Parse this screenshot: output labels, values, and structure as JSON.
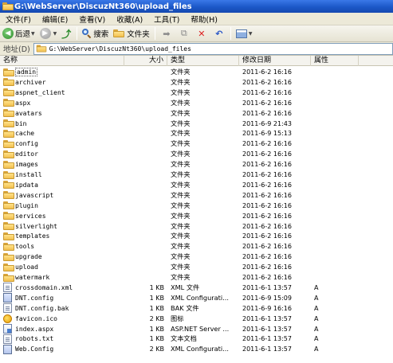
{
  "window": {
    "title": "G:\\WebServer\\DiscuzNt360\\upload_files"
  },
  "menu": [
    "文件(F)",
    "编辑(E)",
    "查看(V)",
    "收藏(A)",
    "工具(T)",
    "帮助(H)"
  ],
  "toolbar": {
    "back_label": "后退",
    "search_label": "搜索",
    "folders_label": "文件夹"
  },
  "address": {
    "label": "地址(D)",
    "value": "G:\\WebServer\\DiscuzNt360\\upload_files"
  },
  "columns": {
    "name": "名称",
    "size": "大小",
    "type": "类型",
    "date": "修改日期",
    "attr": "属性"
  },
  "files": [
    {
      "name": "admin",
      "size": "",
      "type": "文件夹",
      "date": "2011-6-2 16:16",
      "attr": "",
      "icon": "folder-icon"
    },
    {
      "name": "archiver",
      "size": "",
      "type": "文件夹",
      "date": "2011-6-2 16:16",
      "attr": "",
      "icon": "folder-icon"
    },
    {
      "name": "aspnet_client",
      "size": "",
      "type": "文件夹",
      "date": "2011-6-2 16:16",
      "attr": "",
      "icon": "folder-icon"
    },
    {
      "name": "aspx",
      "size": "",
      "type": "文件夹",
      "date": "2011-6-2 16:16",
      "attr": "",
      "icon": "folder-icon"
    },
    {
      "name": "avatars",
      "size": "",
      "type": "文件夹",
      "date": "2011-6-2 16:16",
      "attr": "",
      "icon": "folder-icon"
    },
    {
      "name": "bin",
      "size": "",
      "type": "文件夹",
      "date": "2011-6-9 21:43",
      "attr": "",
      "icon": "folder-icon"
    },
    {
      "name": "cache",
      "size": "",
      "type": "文件夹",
      "date": "2011-6-9 15:13",
      "attr": "",
      "icon": "folder-icon"
    },
    {
      "name": "config",
      "size": "",
      "type": "文件夹",
      "date": "2011-6-2 16:16",
      "attr": "",
      "icon": "folder-icon"
    },
    {
      "name": "editor",
      "size": "",
      "type": "文件夹",
      "date": "2011-6-2 16:16",
      "attr": "",
      "icon": "folder-icon"
    },
    {
      "name": "images",
      "size": "",
      "type": "文件夹",
      "date": "2011-6-2 16:16",
      "attr": "",
      "icon": "folder-icon"
    },
    {
      "name": "install",
      "size": "",
      "type": "文件夹",
      "date": "2011-6-2 16:16",
      "attr": "",
      "icon": "folder-icon"
    },
    {
      "name": "ipdata",
      "size": "",
      "type": "文件夹",
      "date": "2011-6-2 16:16",
      "attr": "",
      "icon": "folder-icon"
    },
    {
      "name": "javascript",
      "size": "",
      "type": "文件夹",
      "date": "2011-6-2 16:16",
      "attr": "",
      "icon": "folder-icon"
    },
    {
      "name": "plugin",
      "size": "",
      "type": "文件夹",
      "date": "2011-6-2 16:16",
      "attr": "",
      "icon": "folder-icon"
    },
    {
      "name": "services",
      "size": "",
      "type": "文件夹",
      "date": "2011-6-2 16:16",
      "attr": "",
      "icon": "folder-icon"
    },
    {
      "name": "silverlight",
      "size": "",
      "type": "文件夹",
      "date": "2011-6-2 16:16",
      "attr": "",
      "icon": "folder-icon"
    },
    {
      "name": "templates",
      "size": "",
      "type": "文件夹",
      "date": "2011-6-2 16:16",
      "attr": "",
      "icon": "folder-icon"
    },
    {
      "name": "tools",
      "size": "",
      "type": "文件夹",
      "date": "2011-6-2 16:16",
      "attr": "",
      "icon": "folder-icon"
    },
    {
      "name": "upgrade",
      "size": "",
      "type": "文件夹",
      "date": "2011-6-2 16:16",
      "attr": "",
      "icon": "folder-icon"
    },
    {
      "name": "upload",
      "size": "",
      "type": "文件夹",
      "date": "2011-6-2 16:16",
      "attr": "",
      "icon": "folder-icon"
    },
    {
      "name": "watermark",
      "size": "",
      "type": "文件夹",
      "date": "2011-6-2 16:16",
      "attr": "",
      "icon": "folder-icon"
    },
    {
      "name": "crossdomain.xml",
      "size": "1 KB",
      "type": "XML 文件",
      "date": "2011-6-1 13:57",
      "attr": "A",
      "icon": "xml-file-icon"
    },
    {
      "name": "DNT.config",
      "size": "1 KB",
      "type": "XML Configurati...",
      "date": "2011-6-9 15:09",
      "attr": "A",
      "icon": "config-file-icon"
    },
    {
      "name": "DNT.config.bak",
      "size": "1 KB",
      "type": "BAK 文件",
      "date": "2011-6-9 16:16",
      "attr": "A",
      "icon": "bak-file-icon"
    },
    {
      "name": "favicon.ico",
      "size": "2 KB",
      "type": "图标",
      "date": "2011-6-1 13:57",
      "attr": "A",
      "icon": "favicon-icon"
    },
    {
      "name": "index.aspx",
      "size": "1 KB",
      "type": "ASP.NET Server ...",
      "date": "2011-6-1 13:57",
      "attr": "A",
      "icon": "aspx-file-icon"
    },
    {
      "name": "robots.txt",
      "size": "1 KB",
      "type": "文本文档",
      "date": "2011-6-1 13:57",
      "attr": "A",
      "icon": "text-file-icon"
    },
    {
      "name": "Web.Config",
      "size": "2 KB",
      "type": "XML Configurati...",
      "date": "2011-6-1 13:57",
      "attr": "A",
      "icon": "config-file-icon"
    }
  ]
}
